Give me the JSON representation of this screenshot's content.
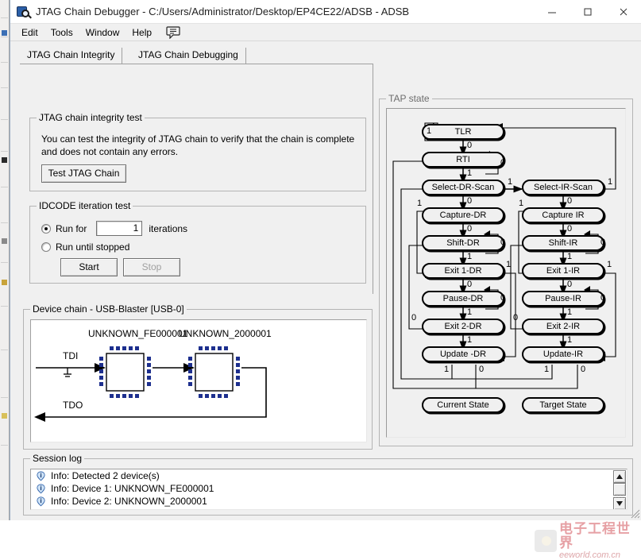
{
  "window": {
    "title": "JTAG Chain Debugger - C:/Users/Administrator/Desktop/EP4CE22/ADSB - ADSB",
    "minimize_label": "–",
    "maximize_label": "□",
    "close_label": "✕"
  },
  "menubar": {
    "items": [
      {
        "label": "Edit"
      },
      {
        "label": "Tools"
      },
      {
        "label": "Window"
      },
      {
        "label": "Help"
      }
    ],
    "speech_icon": "speech-bubble-icon"
  },
  "tabs": [
    {
      "label": "JTAG Chain Integrity",
      "selected": true
    },
    {
      "label": "JTAG Chain Debugging",
      "selected": false
    }
  ],
  "integrity_group": {
    "title": "JTAG chain integrity test",
    "description": "You can test the integrity of JTAG chain to verify that the chain is complete and does not contain any errors.",
    "test_button": "Test JTAG Chain"
  },
  "idcode_group": {
    "title": "IDCODE iteration test",
    "run_for_label": "Run for",
    "iterations_value": "1",
    "iterations_label": "iterations",
    "run_until_stopped_label": "Run until stopped",
    "start_button": "Start",
    "stop_button": "Stop",
    "selected_option": "run_for"
  },
  "device_group": {
    "title": "Device chain - USB-Blaster [USB-0]",
    "tdi_label": "TDI",
    "tdo_label": "TDO",
    "devices": [
      {
        "name": "UNKNOWN_FE000001"
      },
      {
        "name": "UNKNOWN_2000001"
      }
    ]
  },
  "tap_group": {
    "title": "TAP state",
    "current_state_button": "Current State",
    "target_state_button": "Target State",
    "dr_column": [
      "TLR",
      "RTI",
      "Select-DR-Scan",
      "Capture-DR",
      "Shift-DR",
      "Exit 1-DR",
      "Pause-DR",
      "Exit 2-DR",
      "Update -DR"
    ],
    "ir_column": [
      "Select-IR-Scan",
      "Capture IR",
      "Shift-IR",
      "Exit 1-IR",
      "Pause-IR",
      "Exit 2-IR",
      "Update-IR"
    ],
    "edge_labels": {
      "tlr_self": "1",
      "tlr_to_rti": "0",
      "rti_self": "0",
      "rti_to_seldr": "1",
      "seldr_to_capdr": "0",
      "seldr_to_selir": "1",
      "selir_to_capir": "0",
      "selir_to_tlr": "1",
      "capdr_to_shiftdr": "0",
      "capdr_to_exit1dr": "1",
      "shiftdr_self": "0",
      "shiftdr_to_exit1dr": "1",
      "exit1dr_to_pausedr": "0",
      "exit1dr_to_updatedr": "1",
      "pausedr_self": "0",
      "pausedr_to_exit2dr": "1",
      "exit2dr_to_shiftdr": "0",
      "exit2dr_to_updatedr": "1",
      "updatedr_one": "1",
      "updatedr_zero": "0",
      "capir_to_shiftir": "0",
      "capir_to_exit1ir": "1",
      "shiftir_self": "0",
      "shiftir_to_exit1ir": "1",
      "exit1ir_to_pauseir": "0",
      "exit1ir_to_updateir": "1",
      "pauseir_self": "0",
      "pauseir_to_exit2ir": "1",
      "exit2ir_to_shiftir": "0",
      "exit2ir_to_updateir": "1",
      "updateir_one": "1",
      "updateir_zero": "0"
    }
  },
  "log_group": {
    "title": "Session log",
    "entries": [
      {
        "icon": "info-icon",
        "text": "Info: Detected 2 device(s)"
      },
      {
        "icon": "info-icon",
        "text": "Info: Device 1: UNKNOWN_FE000001"
      },
      {
        "icon": "info-icon",
        "text": "Info: Device 2: UNKNOWN_2000001"
      }
    ]
  },
  "watermark": {
    "cn": "电子工程世界",
    "en": "eeworld.com.cn"
  },
  "colors": {
    "window_bg": "#f0f0f0",
    "titlebar_bg": "#ffffff",
    "border": "#b4b4b4",
    "chip_pin": "#1d2f8e",
    "watermark_red": "#d2535a"
  }
}
